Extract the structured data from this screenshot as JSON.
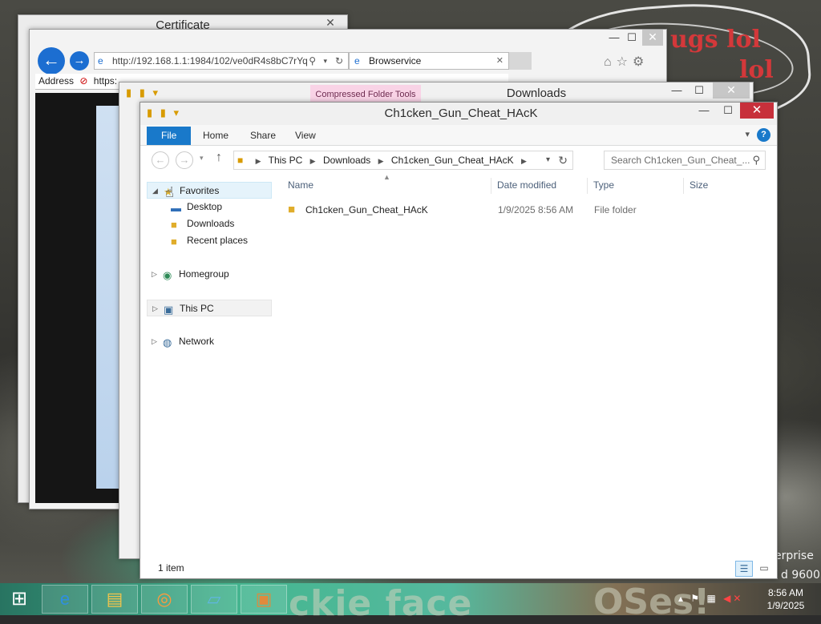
{
  "background": {
    "text_top": "ugs lol",
    "text_lol": "lol",
    "watermark_line1": "erprise",
    "watermark_line2": "d 9600",
    "taskbar_text": "ckie face",
    "taskbar_text2": "OSes!"
  },
  "windows": {
    "certificate": {
      "title": "Certificate",
      "close_label": "✕",
      "address_label": "Address",
      "address_value": "https:"
    },
    "ie": {
      "url": "http://192.168.1.1:1984/102/ve0dR4s8bC7rYq",
      "tab_label": "Browservice",
      "tab_close": "✕",
      "min": "—",
      "max": "☐",
      "close": "✕"
    },
    "downloads": {
      "title": "Downloads",
      "context_tab": "Compressed Folder Tools",
      "min": "—",
      "max": "☐",
      "close": "✕"
    },
    "explorer": {
      "title": "Ch1cken_Gun_Cheat_HAcK",
      "min": "—",
      "max": "☐",
      "close": "✕",
      "ribbon": {
        "file": "File",
        "home": "Home",
        "share": "Share",
        "view": "View",
        "help": "?"
      },
      "breadcrumb": [
        "This PC",
        "Downloads",
        "Ch1cken_Gun_Cheat_HAcK"
      ],
      "search_placeholder": "Search Ch1cken_Gun_Cheat_...",
      "nav": {
        "favorites": "Favorites",
        "desktop": "Desktop",
        "downloads": "Downloads",
        "recent": "Recent places",
        "homegroup": "Homegroup",
        "this_pc": "This PC",
        "network": "Network"
      },
      "columns": {
        "name": "Name",
        "date": "Date modified",
        "type": "Type",
        "size": "Size"
      },
      "files": [
        {
          "name": "Ch1cken_Gun_Cheat_HAcK",
          "date": "1/9/2025 8:56 AM",
          "type": "File folder",
          "size": ""
        }
      ],
      "status": "1 item"
    }
  },
  "taskbar": {
    "start_icon": "windows-logo",
    "apps": [
      "internet-explorer",
      "file-explorer",
      "media-player",
      "notebook",
      "certificate"
    ],
    "time": "8:56 AM",
    "date": "1/9/2025"
  },
  "colors": {
    "accent": "#1979ca",
    "close_red": "#c7303b",
    "folder": "#e0ad2b",
    "ie_blue": "#1c6ed1"
  }
}
